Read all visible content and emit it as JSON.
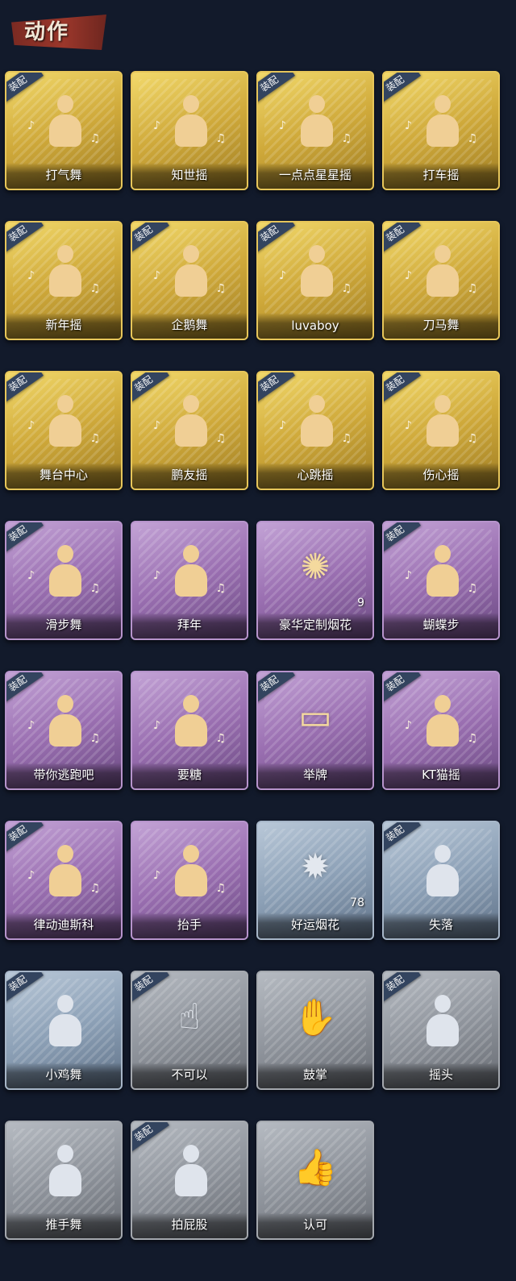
{
  "header": {
    "title": "动作"
  },
  "badge_text": "装配",
  "actions": [
    {
      "label": "打气舞",
      "rarity": "gold",
      "equipped": true,
      "icon": "dance-figure-icon"
    },
    {
      "label": "知世摇",
      "rarity": "gold",
      "equipped": false,
      "icon": "dance-figure-icon"
    },
    {
      "label": "一点点星星摇",
      "rarity": "gold",
      "equipped": true,
      "icon": "dance-figure-icon"
    },
    {
      "label": "打车摇",
      "rarity": "gold",
      "equipped": true,
      "icon": "dance-figure-icon"
    },
    {
      "label": "新年摇",
      "rarity": "gold",
      "equipped": true,
      "icon": "dance-figure-icon"
    },
    {
      "label": "企鹅舞",
      "rarity": "gold",
      "equipped": true,
      "icon": "dance-figure-icon"
    },
    {
      "label": "luvaboy",
      "rarity": "gold",
      "equipped": true,
      "icon": "dance-figure-icon"
    },
    {
      "label": "刀马舞",
      "rarity": "gold",
      "equipped": true,
      "icon": "dance-figure-icon"
    },
    {
      "label": "舞台中心",
      "rarity": "gold",
      "equipped": true,
      "icon": "dance-figure-icon"
    },
    {
      "label": "鹏友摇",
      "rarity": "gold",
      "equipped": true,
      "icon": "dance-figure-icon"
    },
    {
      "label": "心跳摇",
      "rarity": "gold",
      "equipped": true,
      "icon": "dance-figure-icon"
    },
    {
      "label": "伤心摇",
      "rarity": "gold",
      "equipped": true,
      "icon": "heart-hands-figure-icon"
    },
    {
      "label": "滑步舞",
      "rarity": "purple",
      "equipped": true,
      "icon": "dance-figure-icon"
    },
    {
      "label": "拜年",
      "rarity": "purple",
      "equipped": false,
      "icon": "bow-figure-icon"
    },
    {
      "label": "豪华定制烟花",
      "rarity": "purple",
      "equipped": false,
      "icon": "fireworks-box-icon",
      "count": "9"
    },
    {
      "label": "蝴蝶步",
      "rarity": "purple",
      "equipped": true,
      "icon": "dance-figure-icon"
    },
    {
      "label": "带你逃跑吧",
      "rarity": "purple",
      "equipped": true,
      "icon": "dance-figure-icon"
    },
    {
      "label": "要糖",
      "rarity": "purple",
      "equipped": false,
      "icon": "reach-figure-icon"
    },
    {
      "label": "举牌",
      "rarity": "purple",
      "equipped": true,
      "icon": "sign-holding-icon"
    },
    {
      "label": "KT猫摇",
      "rarity": "purple",
      "equipped": true,
      "icon": "dance-figure-icon"
    },
    {
      "label": "律动迪斯科",
      "rarity": "purple",
      "equipped": true,
      "icon": "disco-figure-icon"
    },
    {
      "label": "抬手",
      "rarity": "purple",
      "equipped": false,
      "icon": "raise-hand-figure-icon"
    },
    {
      "label": "好运烟花",
      "rarity": "blue",
      "equipped": false,
      "icon": "firework-can-icon",
      "count": "78"
    },
    {
      "label": "失落",
      "rarity": "blue",
      "equipped": true,
      "icon": "crawl-figure-icon"
    },
    {
      "label": "小鸡舞",
      "rarity": "blue",
      "equipped": true,
      "icon": "dance-figure-icon"
    },
    {
      "label": "不可以",
      "rarity": "gray",
      "equipped": true,
      "icon": "finger-wag-icon"
    },
    {
      "label": "鼓掌",
      "rarity": "gray",
      "equipped": false,
      "icon": "clap-hands-icon"
    },
    {
      "label": "摇头",
      "rarity": "gray",
      "equipped": true,
      "icon": "shake-head-figure-icon"
    },
    {
      "label": "推手舞",
      "rarity": "gray",
      "equipped": false,
      "icon": "push-figure-icon"
    },
    {
      "label": "拍屁股",
      "rarity": "gray",
      "equipped": true,
      "icon": "pat-figure-icon"
    },
    {
      "label": "认可",
      "rarity": "gray",
      "equipped": false,
      "icon": "thumbs-up-icon"
    }
  ]
}
